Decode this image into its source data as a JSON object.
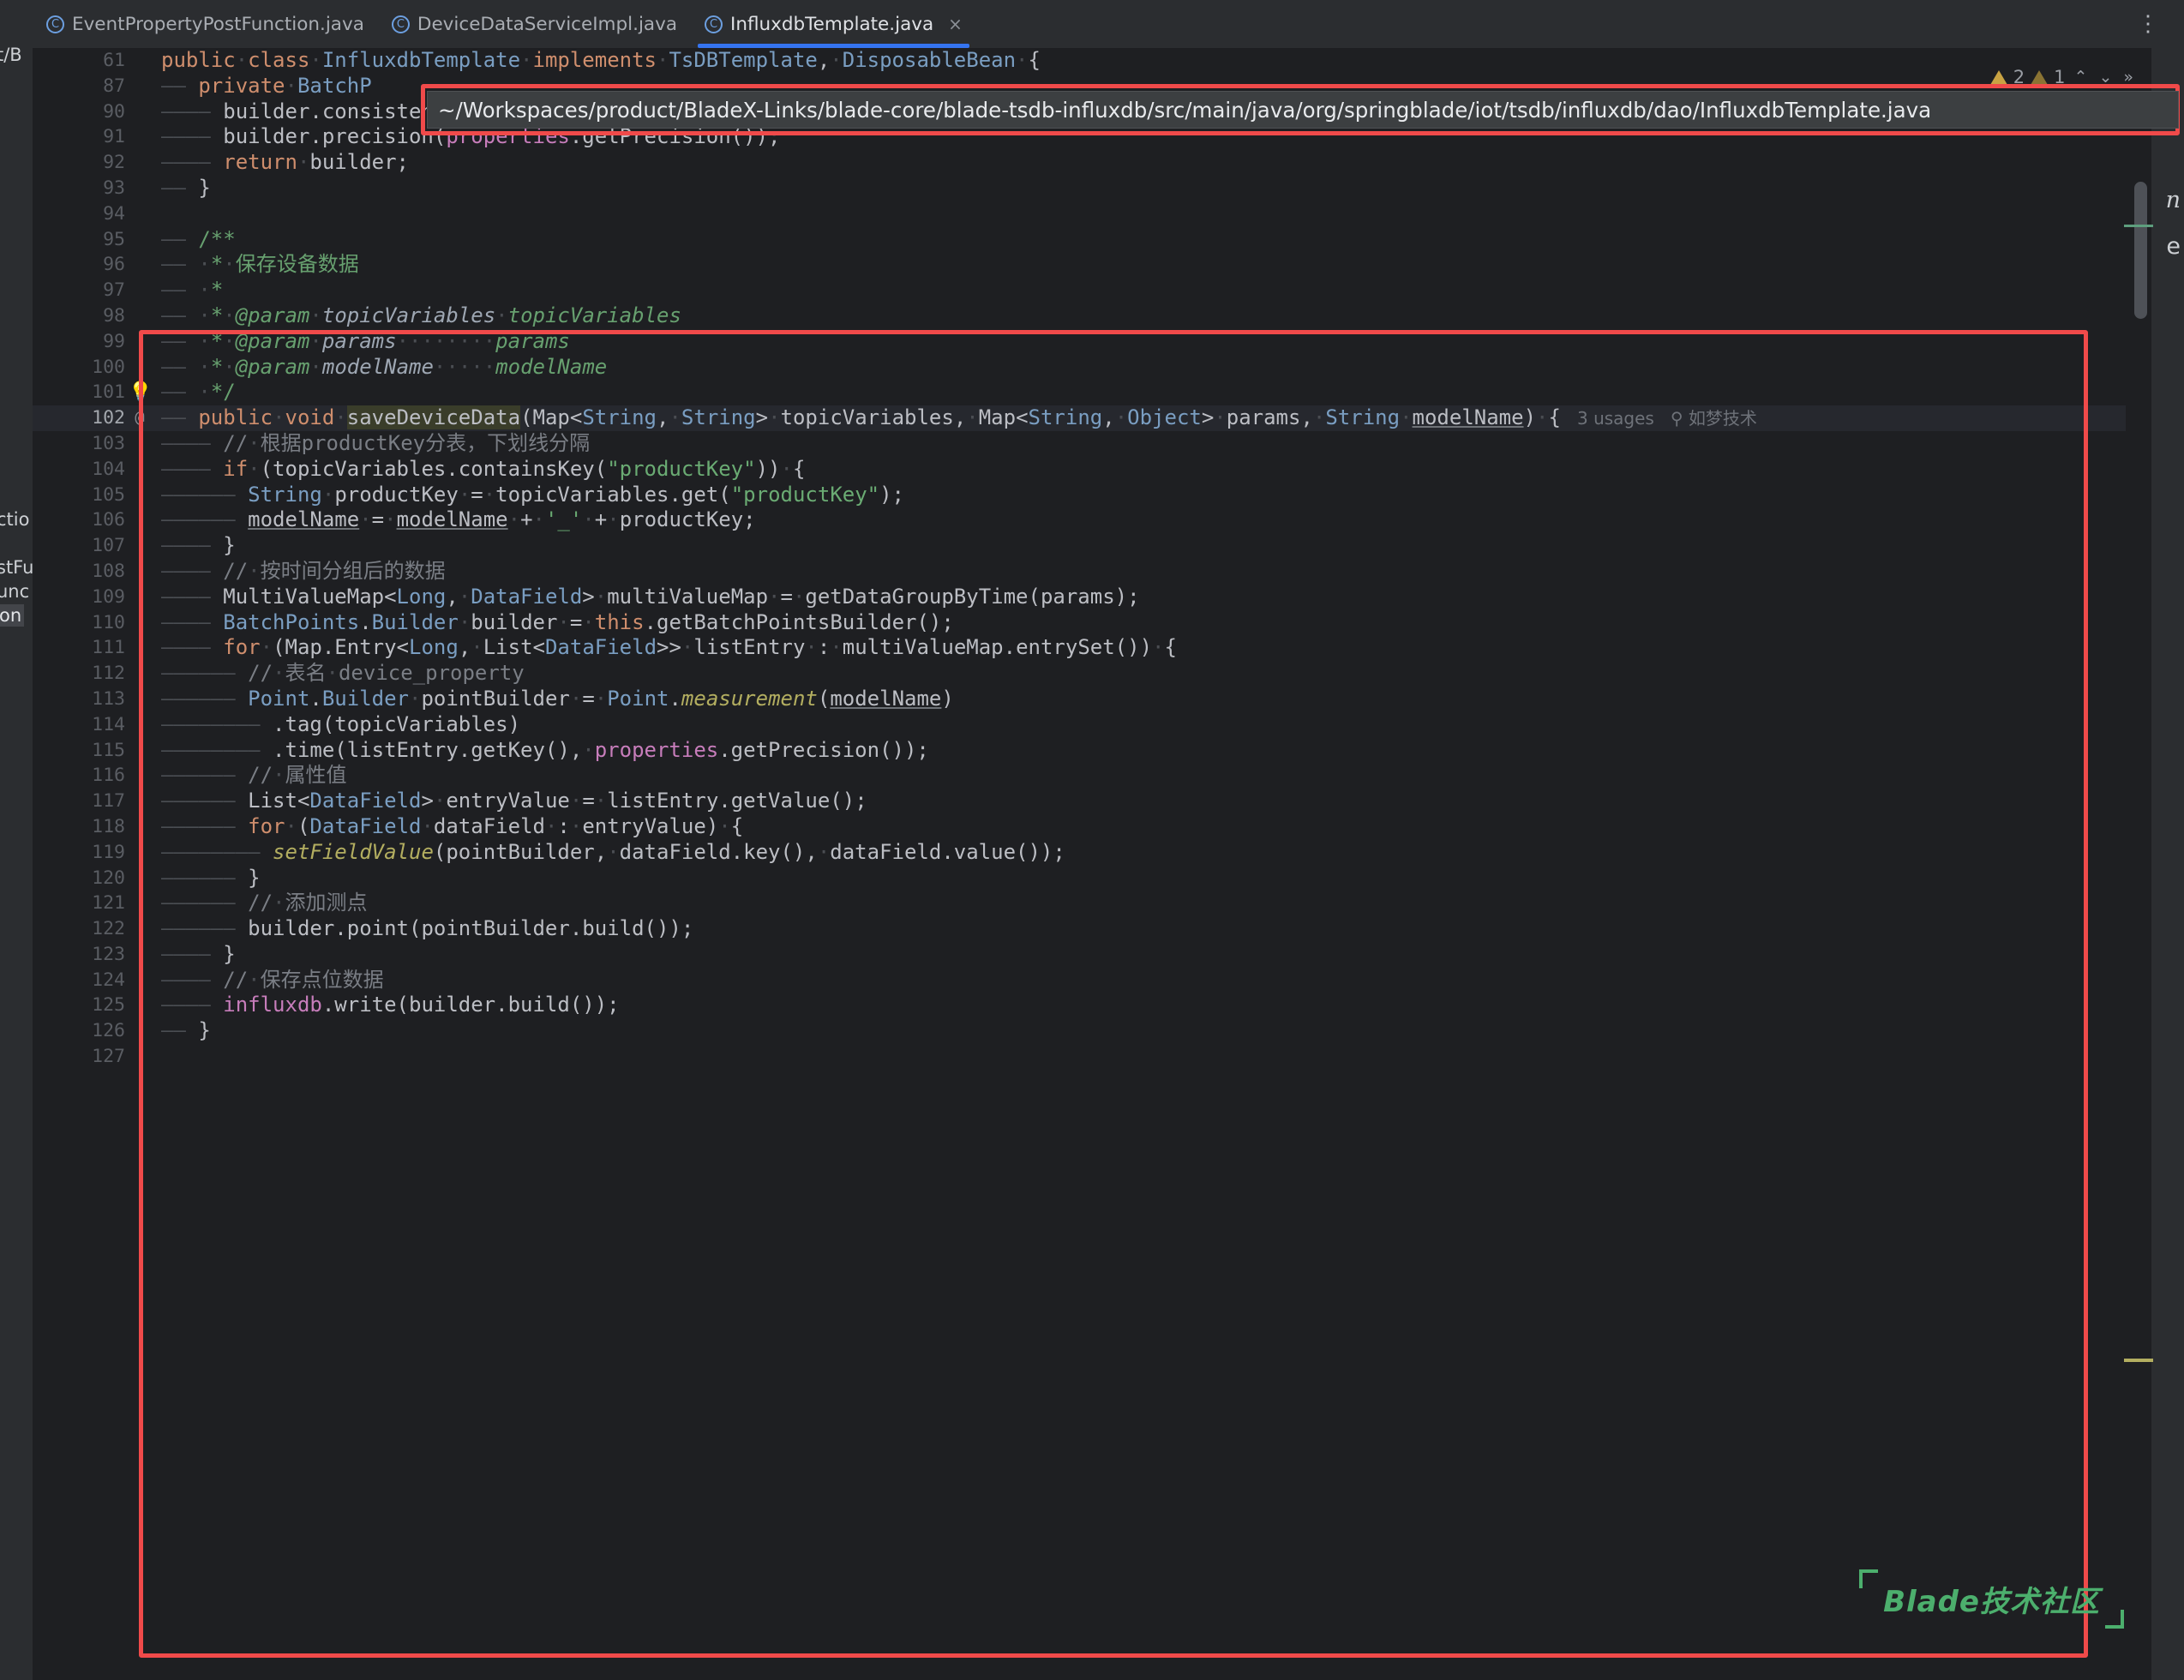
{
  "window": {
    "ide": "IntelliJ IDEA",
    "background_color": "#1e1f22",
    "accent_color": "#3574f0",
    "annotation_color": "#f04a4a"
  },
  "tabs": [
    {
      "label": "EventPropertyPostFunction.java",
      "icon": "java-class-icon",
      "active": false
    },
    {
      "label": "DeviceDataServiceImpl.java",
      "icon": "java-class-icon",
      "active": false
    },
    {
      "label": "InfluxdbTemplate.java",
      "icon": "java-class-icon",
      "active": true,
      "close": "×"
    }
  ],
  "tabbar": {
    "overflow_menu": "⋮"
  },
  "path_tooltip": {
    "text": "~/Workspaces/product/BladeX-Links/blade-core/blade-tsdb-influxdb/src/main/java/org/springblade/iot/tsdb/influxdb/dao/InfluxdbTemplate.java"
  },
  "inspection_widget": {
    "warnings_count": "2",
    "weak_warnings_count": "1",
    "prev_label": "⌃",
    "next_label": "⌄",
    "more_label": "»"
  },
  "left_project_strip": {
    "fragments": [
      "t/B",
      "ctio",
      "stFu",
      "unc",
      "on"
    ]
  },
  "right_strip": {
    "fragments": [
      "n",
      "e"
    ]
  },
  "watermark": {
    "text": "Blade技术社区",
    "color": "#4caf6d"
  },
  "editor": {
    "caret_word": "saveDeviceData",
    "current_line": "102",
    "code_lines": [
      {
        "num": "61",
        "annot": "",
        "current": false,
        "html": "<span class=\"kw\">public</span><span class=\"dot\">·</span><span class=\"kw\">class</span><span class=\"dot\">·</span><span class=\"typ\">InfluxdbTemplate</span><span class=\"dot\">·</span><span class=\"kw\">implements</span><span class=\"dot\">·</span><span class=\"typ\">TsDBTemplate</span>,<span class=\"dot\">·</span><span class=\"typ\">DisposableBean</span><span class=\"dot\">·</span>{"
      },
      {
        "num": "87",
        "annot": "",
        "current": false,
        "html": "<span class=\"ind\">——</span> <span class=\"kw\">private</span><span class=\"dot\">·</span><span class=\"typ\">BatchP</span>"
      },
      {
        "num": "90",
        "annot": "",
        "current": false,
        "html": "<span class=\"ind\">————</span> builder.consistency(<span class=\"fld\">properties</span>.getConsistencyLevel());"
      },
      {
        "num": "91",
        "annot": "",
        "current": false,
        "html": "<span class=\"ind\">————</span> builder.precision(<span class=\"fld\">properties</span>.getPrecision());"
      },
      {
        "num": "92",
        "annot": "",
        "current": false,
        "html": "<span class=\"ind\">————</span> <span class=\"kw\">return</span><span class=\"dot\">·</span>builder;"
      },
      {
        "num": "93",
        "annot": "",
        "current": false,
        "html": "<span class=\"ind\">——</span> }"
      },
      {
        "num": "94",
        "annot": "",
        "current": false,
        "html": ""
      },
      {
        "num": "95",
        "annot": "",
        "current": false,
        "html": "<span class=\"ind\">——</span> <span class=\"doc\">/**</span>"
      },
      {
        "num": "96",
        "annot": "",
        "current": false,
        "html": "<span class=\"ind\">——</span> <span class=\"dot\">·</span><span class=\"doc\">*</span><span class=\"dot\">·</span><span class=\"doc\">保存设备数据</span>"
      },
      {
        "num": "97",
        "annot": "",
        "current": false,
        "html": "<span class=\"ind\">——</span> <span class=\"dot\">·</span><span class=\"doc\">*</span>"
      },
      {
        "num": "98",
        "annot": "",
        "current": false,
        "html": "<span class=\"ind\">——</span> <span class=\"dot\">·</span><span class=\"doc\">*</span><span class=\"dot\">·</span><span class=\"doci\">@param</span><span class=\"dot\">·</span><span class=\"doct\">topicVariables</span><span class=\"dot\">·</span><span class=\"doci\">topicVariables</span>"
      },
      {
        "num": "99",
        "annot": "",
        "current": false,
        "html": "<span class=\"ind\">——</span> <span class=\"dot\">·</span><span class=\"doc\">*</span><span class=\"dot\">·</span><span class=\"doci\">@param</span><span class=\"dot\">·</span><span class=\"doct\">params</span><span class=\"dot\">········</span><span class=\"doci\">params</span>"
      },
      {
        "num": "100",
        "annot": "",
        "current": false,
        "html": "<span class=\"ind\">——</span> <span class=\"dot\">·</span><span class=\"doc\">*</span><span class=\"dot\">·</span><span class=\"doci\">@param</span><span class=\"dot\">·</span><span class=\"doct\">modelName</span><span class=\"dot\">·····</span><span class=\"doci\">modelName</span>"
      },
      {
        "num": "101",
        "annot": "bulb",
        "current": false,
        "html": "<span class=\"ind\">——</span> <span class=\"dot\">·</span><span class=\"doc\">*/</span>"
      },
      {
        "num": "102",
        "annot": "@",
        "current": true,
        "html": "<span class=\"ind\">——</span> <span class=\"kw\">public</span><span class=\"dot\">·</span><span class=\"kw\">void</span><span class=\"dot\">·</span><span class=\"caretword\">saveDeviceData</span>(Map&lt;<span class=\"typ\">String</span>,<span class=\"dot\">·</span><span class=\"typ\">String</span>&gt;<span class=\"dot\">·</span>topicVariables,<span class=\"dot\">·</span>Map&lt;<span class=\"typ\">String</span>,<span class=\"dot\">·</span><span class=\"typ\">Object</span>&gt;<span class=\"dot\">·</span>params,<span class=\"dot\">·</span><span class=\"typ\">String</span><span class=\"dot\">·</span><span class=\"ul\">modelName</span>)<span class=\"dot\">·</span>{<span class=\"usages\">   3 usages   </span><span class=\"author\">⚲ 如梦技术</span>"
      },
      {
        "num": "103",
        "annot": "",
        "current": false,
        "html": "<span class=\"ind\">————</span> <span class=\"cmt\">//</span><span class=\"dot\">·</span><span class=\"cmt\">根据productKey分表，下划线分隔</span>"
      },
      {
        "num": "104",
        "annot": "",
        "current": false,
        "html": "<span class=\"ind\">————</span> <span class=\"kw\">if</span><span class=\"dot\">·</span>(topicVariables.containsKey(<span class=\"str\">\"productKey\"</span>))<span class=\"dot\">·</span>{"
      },
      {
        "num": "105",
        "annot": "",
        "current": false,
        "html": "<span class=\"ind\">——————</span> <span class=\"typ\">String</span><span class=\"dot\">·</span>productKey<span class=\"dot\">·</span>=<span class=\"dot\">·</span>topicVariables.get(<span class=\"str\">\"productKey\"</span>);"
      },
      {
        "num": "106",
        "annot": "",
        "current": false,
        "html": "<span class=\"ind\">——————</span> <span class=\"ul\">modelName</span><span class=\"dot\">·</span>=<span class=\"dot\">·</span><span class=\"ul\">modelName</span><span class=\"dot\">·</span>+<span class=\"dot\">·</span><span class=\"str\">'_'</span><span class=\"dot\">·</span>+<span class=\"dot\">·</span>productKey;"
      },
      {
        "num": "107",
        "annot": "",
        "current": false,
        "html": "<span class=\"ind\">————</span> }"
      },
      {
        "num": "108",
        "annot": "",
        "current": false,
        "html": "<span class=\"ind\">————</span> <span class=\"cmt\">//</span><span class=\"dot\">·</span><span class=\"cmt\">按时间分组后的数据</span>"
      },
      {
        "num": "109",
        "annot": "",
        "current": false,
        "html": "<span class=\"ind\">————</span> MultiValueMap&lt;<span class=\"typ\">Long</span>,<span class=\"dot\">·</span><span class=\"typ\">DataField</span>&gt;<span class=\"dot\">·</span>multiValueMap<span class=\"dot\">·</span>=<span class=\"dot\">·</span>getDataGroupByTime(params);"
      },
      {
        "num": "110",
        "annot": "",
        "current": false,
        "html": "<span class=\"ind\">————</span> <span class=\"typ\">BatchPoints</span>.<span class=\"typ\">Builder</span><span class=\"dot\">·</span>builder<span class=\"dot\">·</span>=<span class=\"dot\">·</span><span class=\"kw\">this</span>.getBatchPointsBuilder();"
      },
      {
        "num": "111",
        "annot": "",
        "current": false,
        "html": "<span class=\"ind\">————</span> <span class=\"kw\">for</span><span class=\"dot\">·</span>(Map.Entry&lt;<span class=\"typ\">Long</span>,<span class=\"dot\">·</span>List&lt;<span class=\"typ\">DataField</span>&gt;&gt;<span class=\"dot\">·</span>listEntry<span class=\"dot\">·</span>:<span class=\"dot\">·</span>multiValueMap.entrySet())<span class=\"dot\">·</span>{"
      },
      {
        "num": "112",
        "annot": "",
        "current": false,
        "html": "<span class=\"ind\">——————</span> <span class=\"cmt\">//</span><span class=\"dot\">·</span><span class=\"cmt\">表名</span><span class=\"dot\">·</span><span class=\"cmt\">device_property</span>"
      },
      {
        "num": "113",
        "annot": "",
        "current": false,
        "html": "<span class=\"ind\">——————</span> <span class=\"typ\">Point</span>.<span class=\"typ\">Builder</span><span class=\"dot\">·</span>pointBuilder<span class=\"dot\">·</span>=<span class=\"dot\">·</span><span class=\"typ\">Point</span>.<span class=\"stat\">measurement</span>(<span class=\"ul\">modelName</span>)"
      },
      {
        "num": "114",
        "annot": "",
        "current": false,
        "html": "<span class=\"ind\">————————</span> .tag(topicVariables)"
      },
      {
        "num": "115",
        "annot": "",
        "current": false,
        "html": "<span class=\"ind\">————————</span> .time(listEntry.getKey(),<span class=\"dot\">·</span><span class=\"fld\">properties</span>.getPrecision());"
      },
      {
        "num": "116",
        "annot": "",
        "current": false,
        "html": "<span class=\"ind\">——————</span> <span class=\"cmt\">//</span><span class=\"dot\">·</span><span class=\"cmt\">属性值</span>"
      },
      {
        "num": "117",
        "annot": "",
        "current": false,
        "html": "<span class=\"ind\">——————</span> List&lt;<span class=\"typ\">DataField</span>&gt;<span class=\"dot\">·</span>entryValue<span class=\"dot\">·</span>=<span class=\"dot\">·</span>listEntry.getValue();"
      },
      {
        "num": "118",
        "annot": "",
        "current": false,
        "html": "<span class=\"ind\">——————</span> <span class=\"kw\">for</span><span class=\"dot\">·</span>(<span class=\"typ\">DataField</span><span class=\"dot\">·</span>dataField<span class=\"dot\">·</span>:<span class=\"dot\">·</span>entryValue)<span class=\"dot\">·</span>{"
      },
      {
        "num": "119",
        "annot": "",
        "current": false,
        "html": "<span class=\"ind\">————————</span> <span class=\"stat\">setFieldValue</span>(pointBuilder,<span class=\"dot\">·</span>dataField.key(),<span class=\"dot\">·</span>dataField.value());"
      },
      {
        "num": "120",
        "annot": "",
        "current": false,
        "html": "<span class=\"ind\">——————</span> }"
      },
      {
        "num": "121",
        "annot": "",
        "current": false,
        "html": "<span class=\"ind\">——————</span> <span class=\"cmt\">//</span><span class=\"dot\">·</span><span class=\"cmt\">添加测点</span>"
      },
      {
        "num": "122",
        "annot": "",
        "current": false,
        "html": "<span class=\"ind\">——————</span> builder.point(pointBuilder.build());"
      },
      {
        "num": "123",
        "annot": "",
        "current": false,
        "html": "<span class=\"ind\">————</span> }"
      },
      {
        "num": "124",
        "annot": "",
        "current": false,
        "html": "<span class=\"ind\">————</span> <span class=\"cmt\">//</span><span class=\"dot\">·</span><span class=\"cmt\">保存点位数据</span>"
      },
      {
        "num": "125",
        "annot": "",
        "current": false,
        "html": "<span class=\"ind\">————</span> <span class=\"fld\">influxdb</span>.write(builder.build());"
      },
      {
        "num": "126",
        "annot": "",
        "current": false,
        "html": "<span class=\"ind\">——</span> }"
      },
      {
        "num": "127",
        "annot": "",
        "current": false,
        "html": ""
      }
    ]
  }
}
